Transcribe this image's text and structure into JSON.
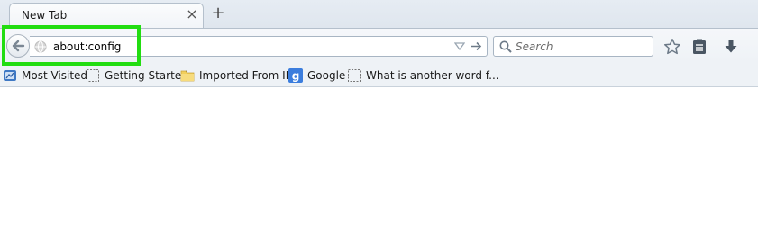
{
  "tabs": [
    {
      "title": "New Tab",
      "close_icon": "close-icon"
    }
  ],
  "newtab_icon": "plus-icon",
  "navbar": {
    "back_icon": "back-arrow-icon",
    "url": "about:config",
    "search_placeholder": "Search",
    "icons": [
      "star-icon",
      "reading-list-icon",
      "download-icon"
    ]
  },
  "bookmarks": [
    {
      "label": "Most Visited",
      "icon": "most-visited-icon"
    },
    {
      "label": "Getting Started",
      "icon": "page-icon"
    },
    {
      "label": "Imported From IE",
      "icon": "folder-icon"
    },
    {
      "label": "Google",
      "icon": "google-icon"
    },
    {
      "label": "What is another word f...",
      "icon": "page-icon"
    }
  ],
  "colors": {
    "highlight": "#22dd11",
    "google_icon_bg": "#3b7ddd",
    "folder": "#f2cf5c"
  }
}
